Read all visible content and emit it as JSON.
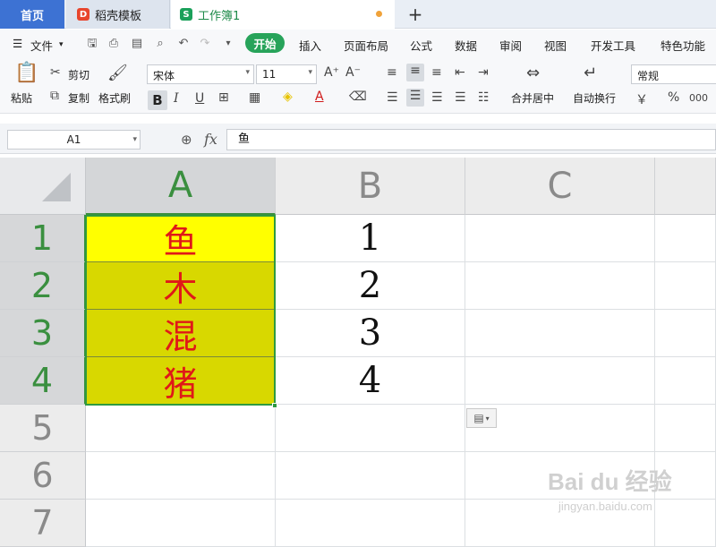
{
  "tabs": {
    "home": "首页",
    "templates": "稻壳模板",
    "workbook": "工作簿1",
    "templates_icon": "D",
    "workbook_icon": "S",
    "new_tab": "+"
  },
  "menu": {
    "file": "文件",
    "file_icon": "☰",
    "items": [
      "开始",
      "插入",
      "页面布局",
      "公式",
      "数据",
      "审阅",
      "视图",
      "开发工具",
      "特色功能"
    ],
    "quick_icons": [
      "save-icon",
      "print-preview-icon",
      "print-icon",
      "zoom-icon",
      "undo-icon",
      "redo-icon",
      "more-icon"
    ]
  },
  "toolbar": {
    "paste": "粘贴",
    "cut": "剪切",
    "copy": "复制",
    "format_painter": "格式刷",
    "font_name": "宋体",
    "font_size": "11",
    "merge_center": "合并居中",
    "wrap_text": "自动换行",
    "number_format": "常规",
    "currency_symbol": "￥",
    "percent_symbol": "%",
    "thousands_symbol": "000",
    "bold": "B",
    "italic": "I",
    "underline": "U",
    "increase_font": "A⁺",
    "decrease_font": "A⁻"
  },
  "formula_bar": {
    "cell_ref": "A1",
    "fx": "fx",
    "content": "鱼"
  },
  "grid": {
    "columns": [
      "A",
      "B",
      "C"
    ],
    "rows": [
      "1",
      "2",
      "3",
      "4",
      "5",
      "6",
      "7"
    ],
    "col_a": [
      "鱼",
      "木",
      "混",
      "猪"
    ],
    "col_b": [
      "1",
      "2",
      "3",
      "4"
    ],
    "selected_column": "A",
    "selected_rows": [
      "1",
      "2",
      "3",
      "4"
    ],
    "selection_color": "#2f9a3f",
    "highlight_first": "#ffff00",
    "highlight_rest": "#d8d800",
    "text_red": "#e01818"
  },
  "watermark": {
    "brand": "Bai du 经验",
    "url": "jingyan.baidu.com"
  }
}
